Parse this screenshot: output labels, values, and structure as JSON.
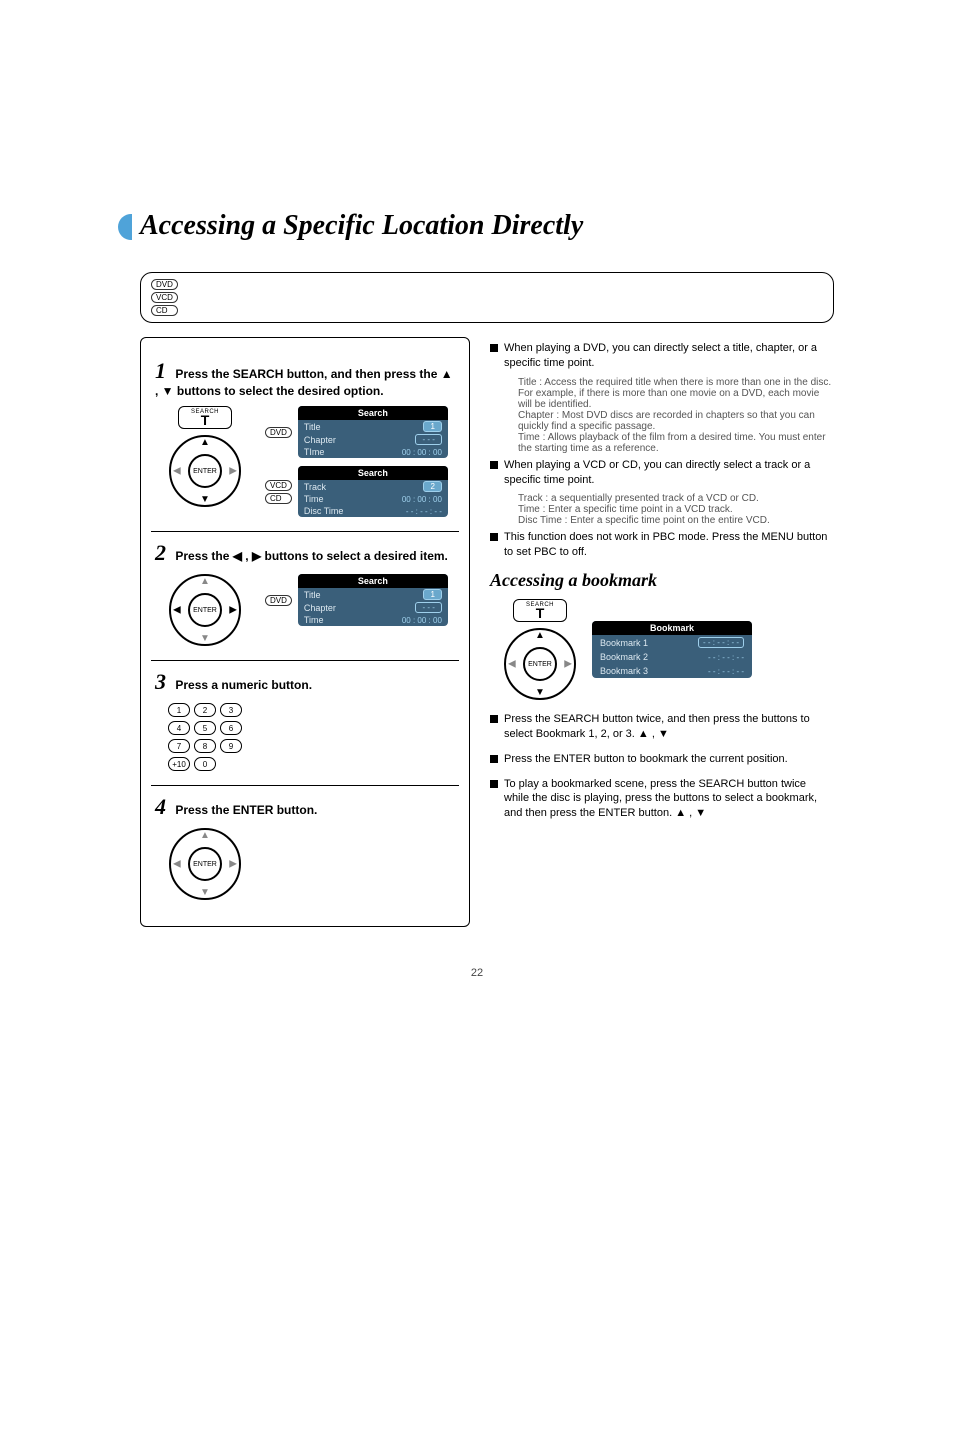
{
  "title": "Accessing a Specific Location Directly",
  "disc_badges": [
    "DVD",
    "VCD",
    "CD"
  ],
  "left": {
    "step1": {
      "heading_prefix": "Press the SEARCH button, and then press the",
      "heading_suffix": "buttons to select the desired option.",
      "num": "1",
      "search_label": "SEARCH",
      "search_key": "T",
      "enter_label": "ENTER",
      "osd_dvd": {
        "title": "Search",
        "rows": [
          {
            "k": "Title",
            "v": "1",
            "sel": true
          },
          {
            "k": "Chapter",
            "v": "- - -"
          },
          {
            "k": "TIme",
            "v": "00 : 00 : 00"
          }
        ],
        "badge": "DVD"
      },
      "osd_vcd": {
        "title": "Search",
        "rows": [
          {
            "k": "Track",
            "v": "2",
            "sel": true
          },
          {
            "k": "Time",
            "v": "00 : 00 : 00"
          },
          {
            "k": "Disc Time",
            "v": "- - : - - : - -"
          }
        ],
        "badges": [
          "VCD",
          "CD"
        ]
      }
    },
    "step2": {
      "num": "2",
      "heading_prefix": "Press the",
      "heading_suffix": "buttons to select a desired item.",
      "enter_label": "ENTER",
      "osd": {
        "title": "Search",
        "rows": [
          {
            "k": "Title",
            "v": "1",
            "sel": true
          },
          {
            "k": "Chapter",
            "v": "- - -"
          },
          {
            "k": "Time",
            "v": "00 : 00 : 00"
          }
        ],
        "badge": "DVD"
      }
    },
    "step3": {
      "num": "3",
      "heading": "Press a numeric button.",
      "keys": [
        "1",
        "2",
        "3",
        "4",
        "5",
        "6",
        "7",
        "8",
        "9",
        "+10",
        "0"
      ]
    },
    "step4": {
      "num": "4",
      "heading": "Press the ENTER button.",
      "enter_label": "ENTER"
    }
  },
  "right": {
    "bookmark_heading": "Accessing a bookmark",
    "b1": {
      "text": "When playing a DVD, you can directly select a title, chapter, or a specific time point.",
      "sub1": "Title : Access the required title when there is more than one in the disc. For example, if there is more than one movie on a DVD, each movie will be identified.",
      "sub2": "Chapter : Most DVD discs are recorded in chapters so that you can quickly find a specific passage.",
      "sub3": "Time : Allows playback of the film from a desired time. You must enter the starting time as a reference."
    },
    "b2": {
      "text": "When playing a VCD or CD, you can directly select a track or a specific time point.",
      "sub1": "Track : a sequentially presented track of a VCD or CD.",
      "sub2": "Time : Enter a specific time point in a VCD track.",
      "sub3": "Disc Time : Enter a specific time point on the entire VCD."
    },
    "b3": "This function does not work in PBC mode. Press the MENU button to set PBC to off.",
    "figure": {
      "search_label": "SEARCH",
      "search_key": "T",
      "enter_label": "ENTER",
      "osd": {
        "title": "Bookmark",
        "rows": [
          {
            "k": "Bookmark 1",
            "v": "- - : - - : - -",
            "sel": true
          },
          {
            "k": "Bookmark 2",
            "v": "- - : - - : - -"
          },
          {
            "k": "Bookmark 3",
            "v": "- - : - - : - -"
          }
        ]
      }
    },
    "b4": "Press the SEARCH button twice, and then press the        buttons to select Bookmark 1, 2, or 3.",
    "b5": "Press the ENTER button to bookmark the current position.",
    "b6": "To play a bookmarked scene, press the SEARCH button twice while the disc is playing, press the        buttons to select a bookmark, and then press the ENTER button."
  },
  "page_number": "22"
}
